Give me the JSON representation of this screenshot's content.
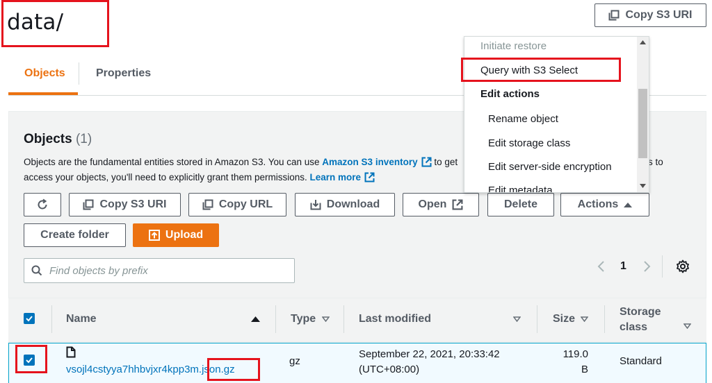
{
  "header": {
    "title": "data/",
    "copy_s3_uri_label": "Copy S3 URI"
  },
  "tabs": [
    {
      "label": "Objects",
      "active": true
    },
    {
      "label": "Properties",
      "active": false
    }
  ],
  "objects_panel": {
    "title": "Objects",
    "count": "(1)",
    "desc_part1": "Objects are the fundamental entities stored in Amazon S3. You can use",
    "inventory_link": "Amazon S3 inventory",
    "desc_part2": "to get",
    "desc_part3": "s to",
    "desc_line2": "access your objects, you'll need to explicitly grant them permissions.",
    "learn_more": "Learn more"
  },
  "toolbar": {
    "copy_s3_uri": "Copy S3 URI",
    "copy_url": "Copy URL",
    "download": "Download",
    "open": "Open",
    "delete": "Delete",
    "actions": "Actions",
    "create_folder": "Create folder",
    "upload": "Upload"
  },
  "search": {
    "placeholder": "Find objects by prefix"
  },
  "pagination": {
    "page": "1"
  },
  "table": {
    "columns": {
      "name": "Name",
      "type": "Type",
      "last_modified": "Last modified",
      "size": "Size",
      "storage_class_1": "Storage",
      "storage_class_2": "class"
    },
    "rows": [
      {
        "name_prefix": "vsojl4cstyya7hhbvjxr4kpp3m",
        "name_ext": ".json.gz",
        "type": "gz",
        "last_modified_1": "September 22, 2021, 20:33:42",
        "last_modified_2": "(UTC+08:00)",
        "size_1": "119.0",
        "size_2": "B",
        "storage_class": "Standard",
        "selected": true
      }
    ]
  },
  "actions_menu": {
    "items": [
      {
        "label": "Initiate restore",
        "kind": "disabled"
      },
      {
        "label": "Query with S3 Select",
        "kind": "item"
      },
      {
        "label": "Edit actions",
        "kind": "group"
      },
      {
        "label": "Rename object",
        "kind": "subitem"
      },
      {
        "label": "Edit storage class",
        "kind": "subitem"
      },
      {
        "label": "Edit server-side encryption",
        "kind": "subitem"
      },
      {
        "label": "Edit metadata",
        "kind": "subitem"
      }
    ]
  },
  "colors": {
    "accent": "#ec7211",
    "link": "#0073bb",
    "annotation_red": "#e5131d"
  }
}
